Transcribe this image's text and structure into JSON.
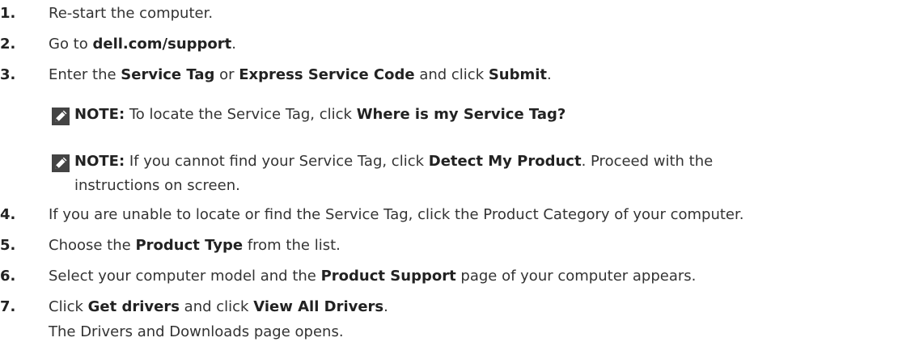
{
  "steps": [
    {
      "num": "1.",
      "text": "Re-start the computer."
    },
    {
      "num": "2.",
      "pre": "Go to ",
      "b1": "dell.com/support",
      "post": "."
    },
    {
      "num": "3.",
      "pre": "Enter the ",
      "b1": "Service Tag",
      "mid1": " or ",
      "b2": "Express Service Code",
      "mid2": " and click ",
      "b3": "Submit",
      "post": "."
    },
    {
      "num": "4.",
      "text": "If you are unable to locate or find the Service Tag, click the Product Category of your computer."
    },
    {
      "num": "5.",
      "pre": "Choose the ",
      "b1": "Product Type",
      "post": " from the list."
    },
    {
      "num": "6.",
      "pre": "Select your computer model and the ",
      "b1": "Product Support",
      "post": " page of your computer appears."
    },
    {
      "num": "7.",
      "pre": "Click ",
      "b1": "Get drivers",
      "mid1": " and click ",
      "b2": "View All Drivers",
      "post": ".",
      "continuation": "The Drivers and Downloads page opens."
    }
  ],
  "notes": [
    {
      "label": "NOTE:",
      "pre": " To locate the Service Tag, click ",
      "b1": "Where is my Service Tag?",
      "icon": "pencil-note-icon"
    },
    {
      "label": "NOTE:",
      "pre": " If you cannot find your Service Tag, click ",
      "b1": "Detect My Product",
      "post": ". Proceed with the",
      "line2": "instructions on screen.",
      "icon": "pencil-note-icon"
    }
  ]
}
